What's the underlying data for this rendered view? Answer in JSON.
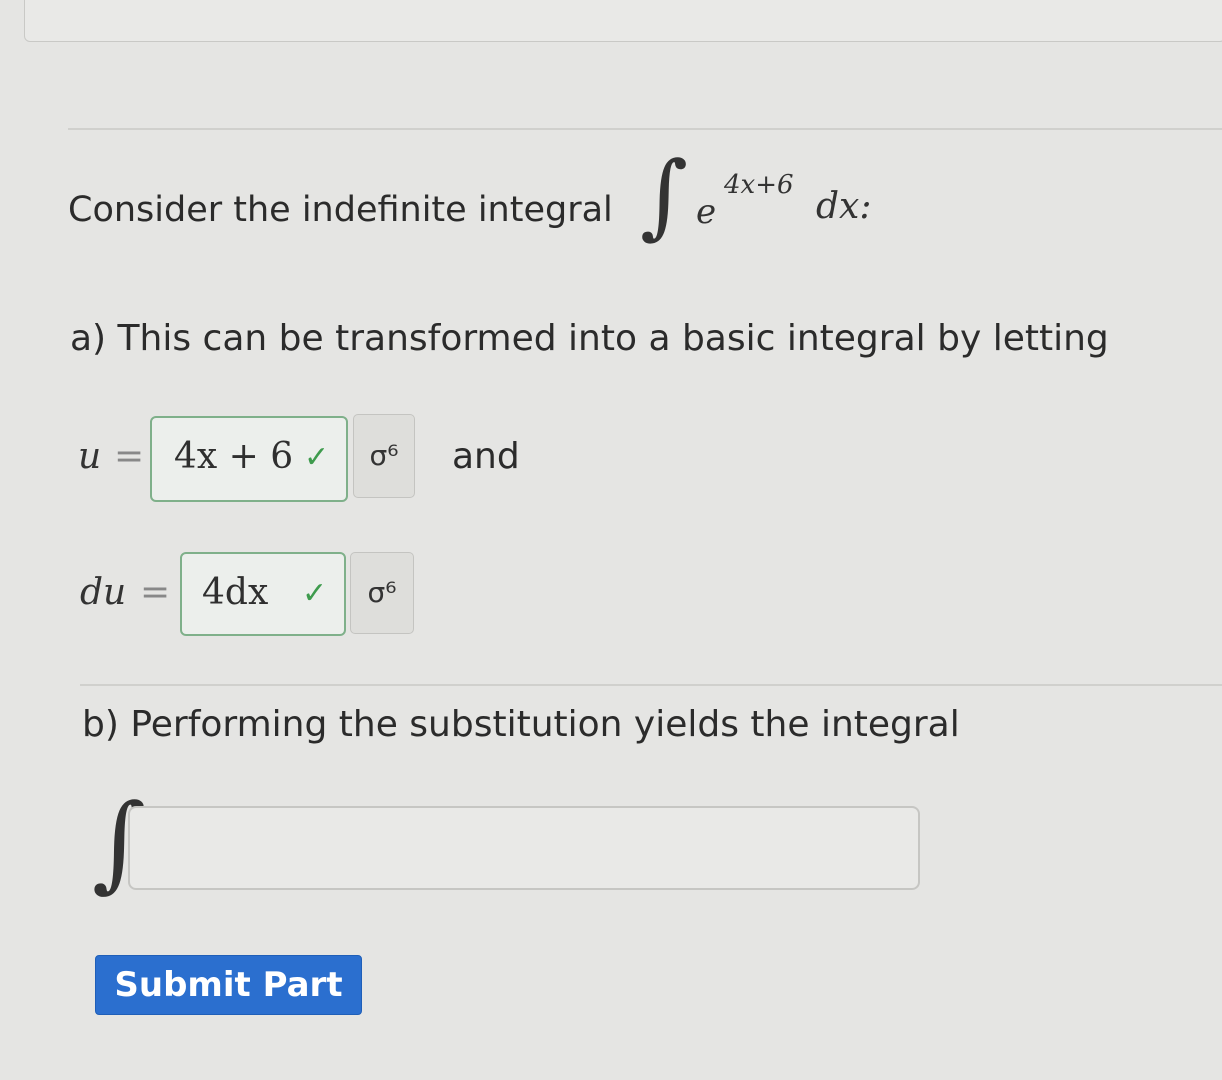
{
  "question": {
    "intro_text": "Consider the indefinite integral",
    "integral_sign": "∫",
    "integrand_base": "e",
    "integrand_exponent": "4x+6",
    "differential": "dx:"
  },
  "part_a": {
    "prompt": "a) This can be transformed into a basic integral by letting",
    "u_label": "u",
    "equals": "=",
    "u_answer": "4x + 6",
    "and_text": "and",
    "du_label": "du",
    "du_answer": "4dx",
    "check_glyph": "✓",
    "symbol_glyph": "σ⁶"
  },
  "part_b": {
    "prompt": "b) Performing the substitution yields the integral",
    "integral_sign": "∫",
    "input_value": ""
  },
  "submit": {
    "label": "Submit Part"
  },
  "colors": {
    "check": "#3e9b4d",
    "answer_border": "#7fb08a",
    "submit_bg": "#2b6fcf"
  },
  "icons": {
    "check": "check-icon",
    "symbol": "symbol-palette-icon"
  }
}
